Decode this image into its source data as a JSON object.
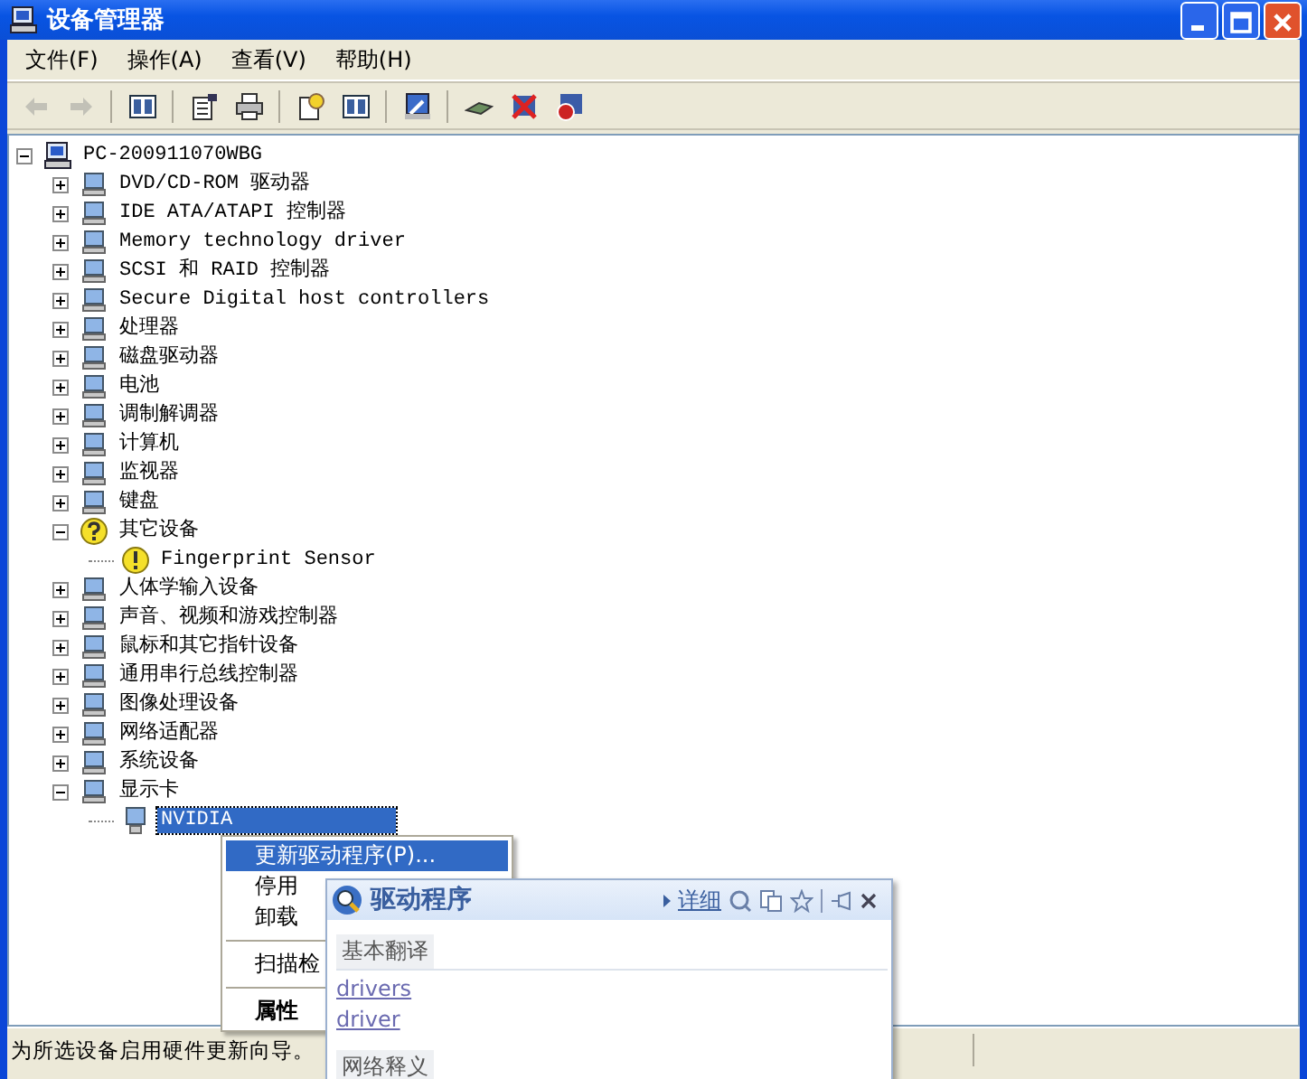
{
  "window": {
    "title": "设备管理器"
  },
  "menu": [
    "文件(F)",
    "操作(A)",
    "查看(V)",
    "帮助(H)"
  ],
  "toolbar": [
    {
      "kind": "back",
      "disabled": true
    },
    {
      "kind": "forward",
      "disabled": true
    },
    {
      "kind": "sep"
    },
    {
      "kind": "panel",
      "disabled": false
    },
    {
      "kind": "sep"
    },
    {
      "kind": "properties",
      "disabled": false
    },
    {
      "kind": "print",
      "disabled": false
    },
    {
      "kind": "sep"
    },
    {
      "kind": "help",
      "disabled": false
    },
    {
      "kind": "panel",
      "disabled": false
    },
    {
      "kind": "sep"
    },
    {
      "kind": "scan",
      "disabled": false
    },
    {
      "kind": "sep"
    },
    {
      "kind": "update",
      "disabled": false
    },
    {
      "kind": "remove",
      "disabled": false
    },
    {
      "kind": "disable",
      "disabled": false
    }
  ],
  "tree": {
    "label": "PC-200911070WBG",
    "expanded": true,
    "children": [
      {
        "label": "DVD/CD-ROM 驱动器",
        "expanded": false
      },
      {
        "label": "IDE ATA/ATAPI 控制器",
        "expanded": false
      },
      {
        "label": "Memory technology driver",
        "expanded": false
      },
      {
        "label": "SCSI 和 RAID 控制器",
        "expanded": false
      },
      {
        "label": "Secure Digital host controllers",
        "expanded": false
      },
      {
        "label": "处理器",
        "expanded": false
      },
      {
        "label": "磁盘驱动器",
        "expanded": false
      },
      {
        "label": "电池",
        "expanded": false
      },
      {
        "label": "调制解调器",
        "expanded": false
      },
      {
        "label": "计算机",
        "expanded": false
      },
      {
        "label": "监视器",
        "expanded": false
      },
      {
        "label": "键盘",
        "expanded": false
      },
      {
        "label": "其它设备",
        "expanded": true,
        "warning": true,
        "children": [
          {
            "label": "Fingerprint Sensor",
            "warning": true,
            "selected": false
          }
        ]
      },
      {
        "label": "人体学输入设备",
        "expanded": false
      },
      {
        "label": "声音、视频和游戏控制器",
        "expanded": false
      },
      {
        "label": "鼠标和其它指针设备",
        "expanded": false
      },
      {
        "label": "通用串行总线控制器",
        "expanded": false
      },
      {
        "label": "图像处理设备",
        "expanded": false
      },
      {
        "label": "网络适配器",
        "expanded": false
      },
      {
        "label": "系统设备",
        "expanded": false
      },
      {
        "label": "显示卡",
        "expanded": true,
        "children": [
          {
            "label": "NVIDIA",
            "warning": false,
            "selected": true
          }
        ]
      }
    ]
  },
  "context_menu": [
    {
      "kind": "item",
      "label": "更新驱动程序(P)...",
      "selected": true,
      "bold": false
    },
    {
      "kind": "item",
      "label": "停用",
      "selected": false,
      "bold": false
    },
    {
      "kind": "item",
      "label": "卸载",
      "selected": false,
      "bold": false
    },
    {
      "kind": "sep"
    },
    {
      "kind": "item",
      "label": "扫描检",
      "selected": false,
      "bold": false
    },
    {
      "kind": "sep"
    },
    {
      "kind": "item",
      "label": "属性",
      "selected": false,
      "bold": true
    }
  ],
  "dictionary_popup": {
    "word": "驱动程序",
    "detail_link": "详细",
    "sections": [
      {
        "heading": "基本翻译",
        "links": [
          "drivers",
          "driver"
        ]
      },
      {
        "heading": "网络释义"
      }
    ]
  },
  "status_bar": "为所选设备启用硬件更新向导。"
}
